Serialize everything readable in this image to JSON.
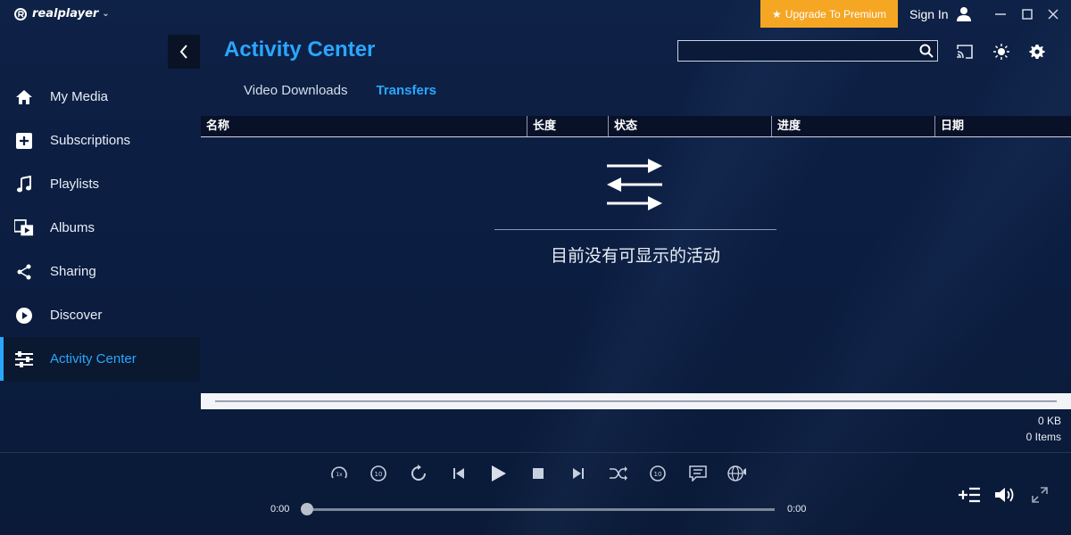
{
  "app": {
    "logo": "realplayer"
  },
  "titlebar": {
    "upgrade_label": "Upgrade To Premium",
    "signin_label": "Sign In"
  },
  "sidebar": {
    "items": [
      {
        "label": "My Media",
        "icon": "home-icon"
      },
      {
        "label": "Subscriptions",
        "icon": "plus-square-icon"
      },
      {
        "label": "Playlists",
        "icon": "music-note-icon"
      },
      {
        "label": "Albums",
        "icon": "albums-icon"
      },
      {
        "label": "Sharing",
        "icon": "share-icon"
      },
      {
        "label": "Discover",
        "icon": "play-circle-icon"
      },
      {
        "label": "Activity Center",
        "icon": "sliders-icon",
        "active": true
      }
    ]
  },
  "header": {
    "title": "Activity Center",
    "search_placeholder": ""
  },
  "tabs": [
    {
      "label": "Video Downloads",
      "active": false
    },
    {
      "label": "Transfers",
      "active": true
    }
  ],
  "table": {
    "columns": [
      "名称",
      "长度",
      "状态",
      "进度",
      "日期"
    ],
    "rows": []
  },
  "empty_state": {
    "message": "目前没有可显示的活动",
    "icon": "transfer-arrows-icon"
  },
  "summary": {
    "size": "0 KB",
    "items": "0 Items"
  },
  "player": {
    "current_time": "0:00",
    "total_time": "0:00",
    "progress": 0
  },
  "colors": {
    "accent": "#2aa7ff",
    "premium": "#f5a623",
    "background": "#0b1d40"
  }
}
